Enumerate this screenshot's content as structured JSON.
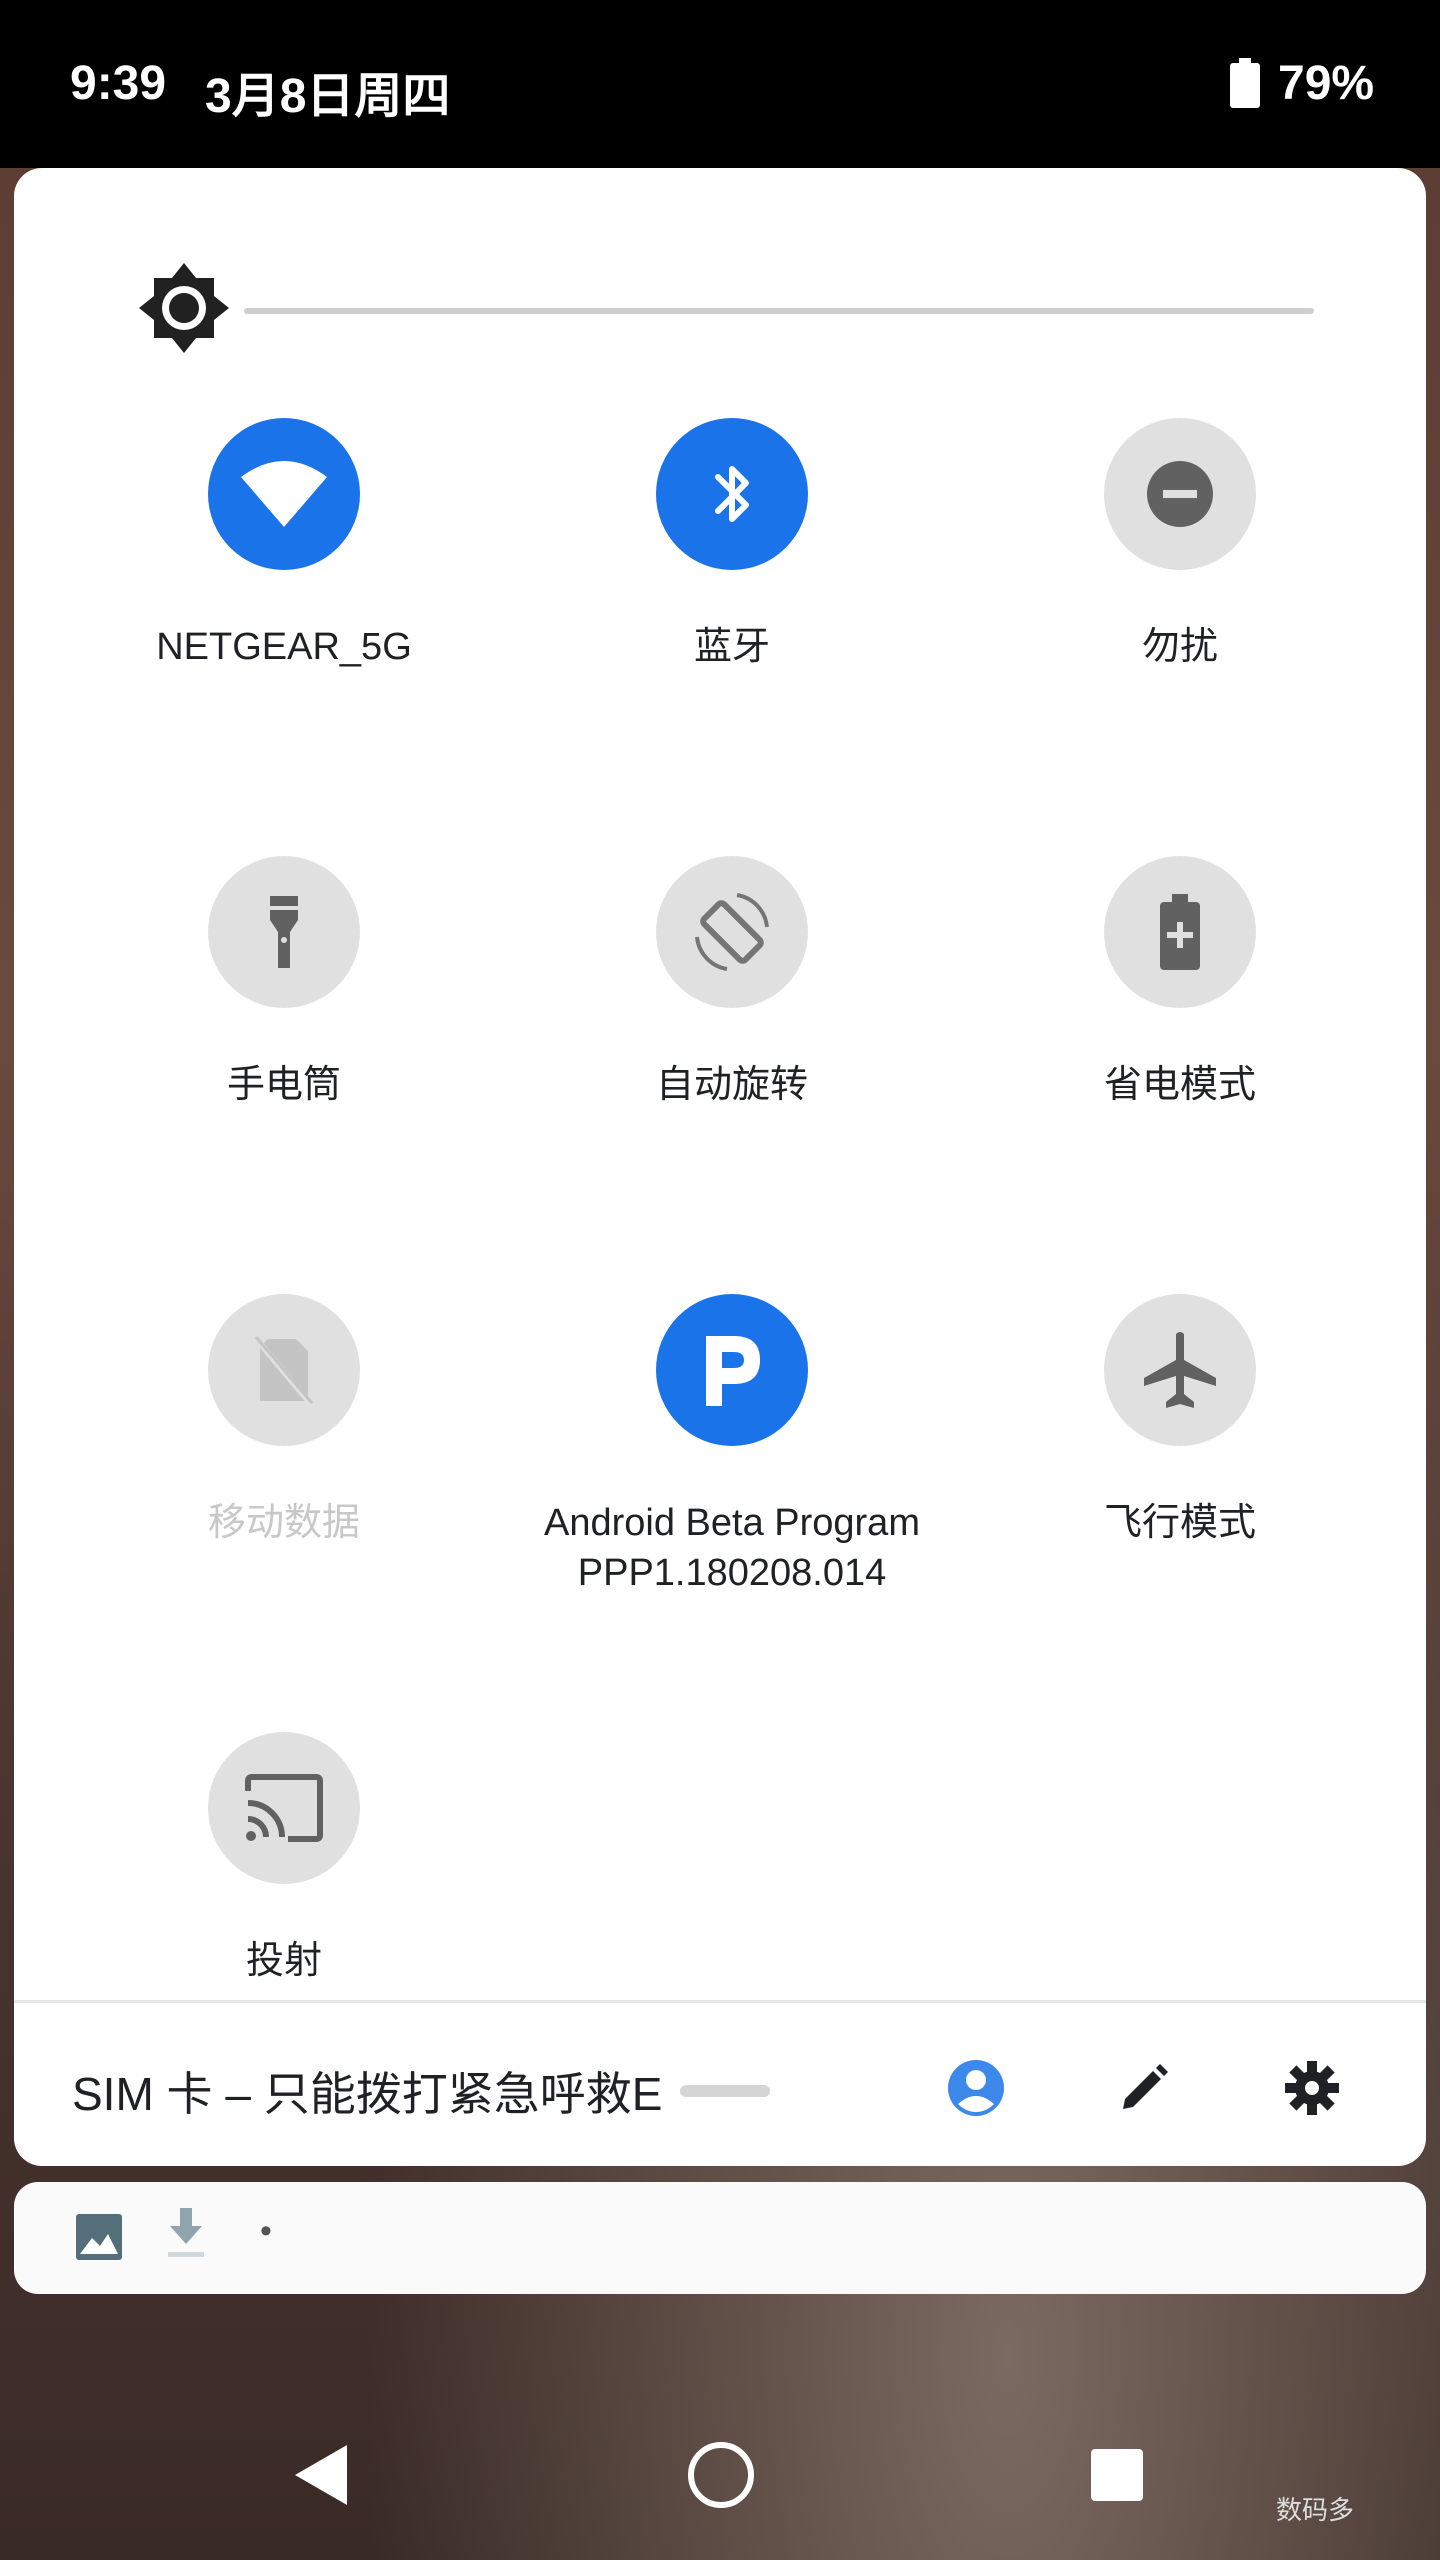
{
  "status": {
    "time": "9:39",
    "date": "3月8日周四",
    "battery": "79%"
  },
  "colors": {
    "accent": "#1a73e8",
    "tile_off": "#e0e0e0",
    "icon_dark": "#616161"
  },
  "quick_settings": {
    "tiles": [
      {
        "label": "NETGEAR_5G",
        "icon": "wifi-icon",
        "state": "on"
      },
      {
        "label": "蓝牙",
        "icon": "bluetooth-icon",
        "state": "on"
      },
      {
        "label": "勿扰",
        "icon": "do-not-disturb-icon",
        "state": "off"
      },
      {
        "label": "手电筒",
        "icon": "flashlight-icon",
        "state": "off"
      },
      {
        "label": "自动旋转",
        "icon": "auto-rotate-icon",
        "state": "off"
      },
      {
        "label": "省电模式",
        "icon": "battery-saver-icon",
        "state": "off"
      },
      {
        "label": "移动数据",
        "icon": "no-sim-icon",
        "state": "disabled"
      },
      {
        "label": "Android Beta Program",
        "sublabel": "PPP1.180208.014",
        "icon": "beta-program-icon",
        "state": "on"
      },
      {
        "label": "飞行模式",
        "icon": "airplane-icon",
        "state": "off"
      },
      {
        "label": "投射",
        "icon": "cast-icon",
        "state": "off"
      }
    ]
  },
  "footer": {
    "carrier_text": "SIM 卡 – 只能拨打紧急呼救E"
  },
  "notification_row": {
    "dot": "•"
  },
  "watermark": "数码多"
}
